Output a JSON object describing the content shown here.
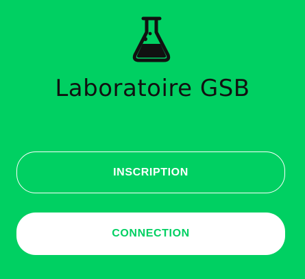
{
  "app": {
    "title": "Laboratoire GSB",
    "logo_icon": "flask-icon"
  },
  "actions": {
    "signup_label": "INSCRIPTION",
    "login_label": "CONNECTION"
  },
  "colors": {
    "background": "#00d062",
    "text_dark": "#111111",
    "button_outline": "#ffffff",
    "button_fill": "#ffffff"
  }
}
